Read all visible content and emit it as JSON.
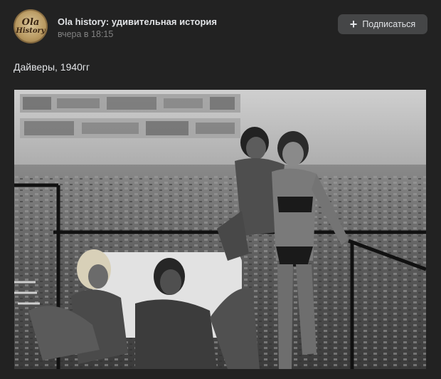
{
  "header": {
    "avatar_logo_text": "Ola History",
    "group_name": "Ola history: удивительная история",
    "post_time": "вчера в 18:15",
    "subscribe_label": "Подписаться",
    "plus_icon": "plus-icon"
  },
  "post": {
    "text": "Дайверы, 1940гг"
  },
  "photo": {
    "style": "black-and-white",
    "content": "four people on a rooftop terrace overlooking a city"
  },
  "colors": {
    "background": "#222222",
    "button_bg": "#454647",
    "text_primary": "#e1e3e6",
    "text_secondary": "#828282"
  }
}
